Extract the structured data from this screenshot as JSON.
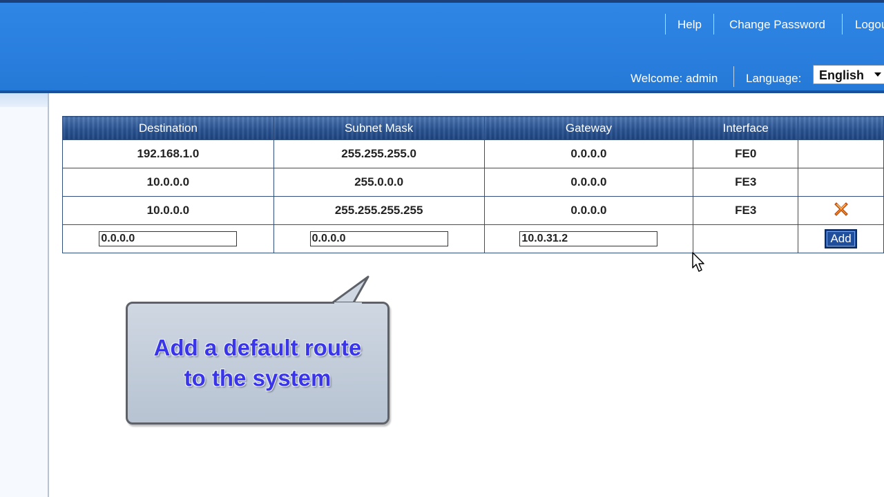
{
  "header": {
    "links": [
      {
        "label": "Help"
      },
      {
        "label": "Change Password"
      },
      {
        "label": "Logout"
      }
    ],
    "welcome": "Welcome: admin",
    "language_label": "Language:",
    "language_selected": "English"
  },
  "routes": {
    "columns": [
      "Destination",
      "Subnet Mask",
      "Gateway",
      "Interface",
      ""
    ],
    "rows": [
      {
        "destination": "192.168.1.0",
        "mask": "255.255.255.0",
        "gateway": "0.0.0.0",
        "interface": "FE0",
        "deletable": false
      },
      {
        "destination": "10.0.0.0",
        "mask": "255.0.0.0",
        "gateway": "0.0.0.0",
        "interface": "FE3",
        "deletable": false
      },
      {
        "destination": "10.0.0.0",
        "mask": "255.255.255.255",
        "gateway": "0.0.0.0",
        "interface": "FE3",
        "deletable": true
      }
    ],
    "new_route": {
      "destination": "0.0.0.0",
      "mask": "0.0.0.0",
      "gateway": "10.0.31.2",
      "add_label": "Add"
    }
  },
  "callout": {
    "line1": "Add a default route",
    "line2": "to the system"
  },
  "icons": {
    "delete": "delete-x-icon",
    "cursor": "mouse-pointer-icon"
  },
  "colors": {
    "header_blue": "#2a7fde",
    "table_header": "#2b5594",
    "add_button": "#1f4f9c",
    "callout_text": "#3a36e8",
    "delete_icon": "#e8731c"
  }
}
